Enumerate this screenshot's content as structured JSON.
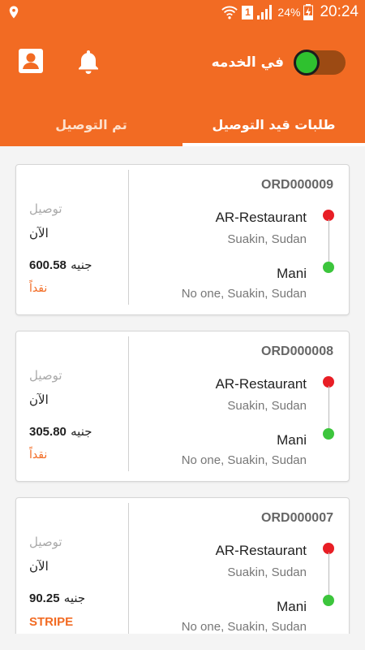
{
  "status_bar": {
    "sim_slot": "1",
    "battery": "24%",
    "time": "20:24"
  },
  "header": {
    "duty_label": "في الخدمه",
    "duty_on": true,
    "colors": {
      "accent": "#f26b23",
      "toggle_on": "#2fc12f"
    }
  },
  "tabs": [
    {
      "label": "طلبات قيد التوصيل",
      "active": true
    },
    {
      "label": "تم التوصيل",
      "active": false
    }
  ],
  "orders": [
    {
      "id": "ORD000009",
      "pickup_name": "AR-Restaurant",
      "pickup_address": "Suakin, Sudan",
      "dropoff_name": "Mani",
      "dropoff_address": "No one, Suakin, Sudan",
      "type": "توصيل",
      "time": "الآن",
      "amount": "600.58",
      "currency": "جنيه",
      "payment": "نقداً"
    },
    {
      "id": "ORD000008",
      "pickup_name": "AR-Restaurant",
      "pickup_address": "Suakin, Sudan",
      "dropoff_name": "Mani",
      "dropoff_address": "No one, Suakin, Sudan",
      "type": "توصيل",
      "time": "الآن",
      "amount": "305.80",
      "currency": "جنيه",
      "payment": "نقداً"
    },
    {
      "id": "ORD000007",
      "pickup_name": "AR-Restaurant",
      "pickup_address": "Suakin, Sudan",
      "dropoff_name": "Mani",
      "dropoff_address": "No one, Suakin, Sudan",
      "type": "توصيل",
      "time": "الآن",
      "amount": "90.25",
      "currency": "جنيه",
      "payment": "STRIPE"
    }
  ]
}
